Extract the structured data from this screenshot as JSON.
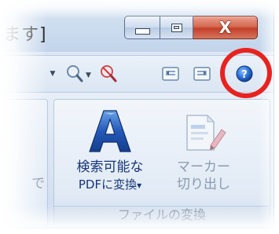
{
  "window": {
    "title_fragment": "ます]",
    "caption_buttons": {
      "minimize_icon": "minimize-icon",
      "maximize_icon": "maximize-icon",
      "close_label": "X"
    }
  },
  "toolbar": {
    "items": [
      {
        "name": "dropdown-arrow",
        "icon": "chevron-down-icon"
      },
      {
        "name": "zoom-in",
        "icon": "magnifier-icon"
      },
      {
        "name": "zoom-out",
        "icon": "magnifier-no-icon"
      },
      {
        "name": "prev-page",
        "icon": "page-prev-icon"
      },
      {
        "name": "next-page",
        "icon": "page-next-icon"
      },
      {
        "name": "help",
        "icon": "help-icon"
      }
    ]
  },
  "ribbon": {
    "prev_group_fragment": "で",
    "group": {
      "label": "ファイルの変換",
      "commands": [
        {
          "line1": "検索可能な",
          "line2": "PDFに変換",
          "dropdown": "▾",
          "icon": "letter-a-icon"
        },
        {
          "line1": "マーカー",
          "line2": "切り出し",
          "icon": "marker-cutout-icon"
        }
      ]
    }
  },
  "annotation": {
    "color": "#e8231f",
    "target": "help-button"
  },
  "colors": {
    "close_red": "#c3402a",
    "help_blue": "#1f5fc9",
    "command_text": "#16357a"
  }
}
